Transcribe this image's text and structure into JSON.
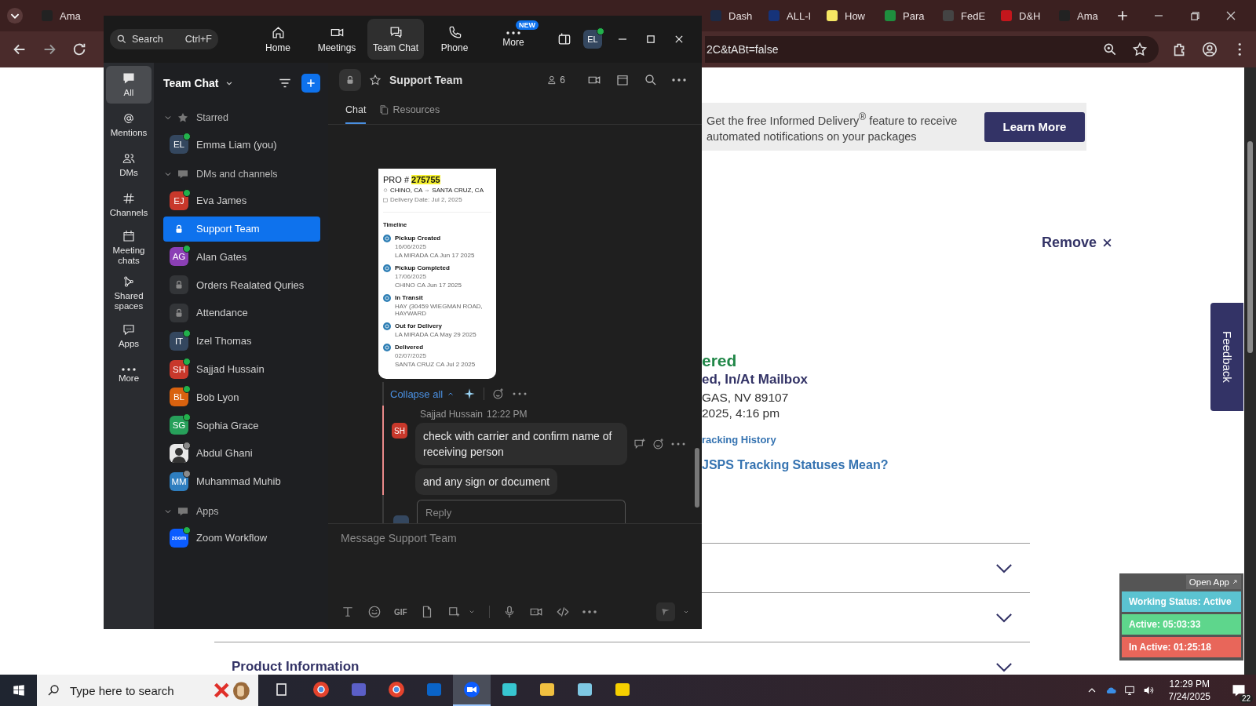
{
  "browser": {
    "tabs": [
      {
        "label": "Ama",
        "selected": false
      },
      {
        "label": "Dash",
        "selected": false
      },
      {
        "label": "ALL-I",
        "selected": false
      },
      {
        "label": "How",
        "selected": false
      },
      {
        "label": "Para",
        "selected": false
      },
      {
        "label": "FedE",
        "selected": false
      },
      {
        "label": "D&H",
        "selected": false
      },
      {
        "label": "Ama",
        "selected": false
      }
    ],
    "address": "2C&tABt=false"
  },
  "zoom": {
    "search": {
      "placeholder": "Search",
      "shortcut": "Ctrl+F"
    },
    "nav": [
      {
        "label": "Home",
        "selected": false
      },
      {
        "label": "Meetings",
        "selected": false
      },
      {
        "label": "Team Chat",
        "selected": true
      },
      {
        "label": "Phone",
        "selected": false
      },
      {
        "label": "More",
        "selected": false,
        "badge": "NEW"
      }
    ],
    "avatar": "EL",
    "rail": [
      {
        "label": "All",
        "selected": true
      },
      {
        "label": "Mentions",
        "selected": false
      },
      {
        "label": "DMs",
        "selected": false
      },
      {
        "label": "Channels",
        "selected": false
      },
      {
        "label": "Meeting chats",
        "selected": false
      },
      {
        "label": "Shared spaces",
        "selected": false
      },
      {
        "label": "Apps",
        "selected": false
      },
      {
        "label": "More",
        "selected": false
      }
    ],
    "sidebar": {
      "title": "Team Chat",
      "sections": [
        {
          "label": "Starred",
          "expanded": true,
          "items": [
            {
              "name": "Emma Liam (you)",
              "kind": "person",
              "initials": "EL",
              "color": "#34475f",
              "online": true,
              "selected": false
            }
          ]
        },
        {
          "label": "DMs and channels",
          "expanded": true,
          "items": [
            {
              "name": "Eva James",
              "kind": "person",
              "initials": "EJ",
              "color": "#c8382b",
              "online": true,
              "selected": false
            },
            {
              "name": "Support Team",
              "kind": "channel",
              "selected": true
            },
            {
              "name": "Alan Gates",
              "kind": "person",
              "initials": "AG",
              "color": "#8b3fb5",
              "online": true,
              "selected": false
            },
            {
              "name": "Orders Realated Quries",
              "kind": "channel",
              "selected": false
            },
            {
              "name": "Attendance",
              "kind": "channel",
              "selected": false
            },
            {
              "name": "Izel Thomas",
              "kind": "person",
              "initials": "IT",
              "color": "#34475f",
              "online": true,
              "selected": false
            },
            {
              "name": "Sajjad Hussain",
              "kind": "person",
              "initials": "SH",
              "color": "#c8382b",
              "online": true,
              "selected": false
            },
            {
              "name": "Bob Lyon",
              "kind": "person",
              "initials": "BL",
              "color": "#d9620f",
              "online": true,
              "selected": false
            },
            {
              "name": "Sophia Grace",
              "kind": "person",
              "initials": "SG",
              "color": "#27a05a",
              "online": true,
              "selected": false
            },
            {
              "name": "Abdul Ghani",
              "kind": "photo",
              "online": false,
              "selected": false
            },
            {
              "name": "Muhammad Muhib",
              "kind": "person",
              "initials": "MM",
              "color": "#2e7ebf",
              "online": false,
              "selected": false
            }
          ]
        },
        {
          "label": "Apps",
          "expanded": true,
          "items": [
            {
              "name": "Zoom Workflow",
              "kind": "app",
              "initials": "zoom",
              "color": "#0b5cff",
              "online": true,
              "selected": false
            }
          ]
        }
      ]
    },
    "chat": {
      "title": "Support Team",
      "members": "6",
      "tabs": [
        {
          "label": "Chat",
          "selected": true
        },
        {
          "label": "Resources",
          "selected": false
        }
      ],
      "card": {
        "pro_label": "PRO #",
        "pro_number": "275755",
        "origin": "CHINO, CA",
        "destination": "SANTA CRUZ, CA",
        "delivery_date": "Delivery Date: Jul 2, 2025",
        "timeline_title": "Timeline",
        "events": [
          {
            "title": "Pickup Created",
            "date": "16/06/2025",
            "place": "LA MIRADA CA Jun 17 2025"
          },
          {
            "title": "Pickup Completed",
            "date": "17/06/2025",
            "place": "CHINO CA Jun 17 2025"
          },
          {
            "title": "In Transit",
            "place": "HAY (30459 WIEGMAN ROAD, HAYWARD"
          },
          {
            "title": "Out for Delivery",
            "place": "LA MIRADA CA May 29 2025"
          },
          {
            "title": "Delivered",
            "date": "02/07/2025",
            "place": "SANTA CRUZ CA Jul 2 2025"
          }
        ]
      },
      "collapse": "Collapse all",
      "message": {
        "author": "Sajjad Hussain",
        "time": "12:22 PM",
        "initials": "SH",
        "color": "#c8382b",
        "bubbles": [
          "check with carrier and confirm name of receiving person",
          "and any sign or document"
        ]
      },
      "reply": {
        "placeholder": "Reply"
      },
      "composer": {
        "placeholder": "Message Support Team",
        "gif": "GIF"
      }
    }
  },
  "page": {
    "banner": {
      "text": "Get the free Informed Delivery$^{®}$ feature to receive automated notifications on your packages",
      "button": "Learn More"
    },
    "remove": "Remove",
    "status": "ered",
    "status_detail": "ed, In/At Mailbox",
    "location": "GAS, NV 89107",
    "datetime": "2025, 4:16 pm",
    "history_link": "racking History",
    "statuses_link": "JSPS Tracking Statuses Mean?",
    "accordions": [
      {
        "expanded": false
      },
      {
        "expanded": false
      },
      {
        "label": "Product Information",
        "expanded": false
      }
    ],
    "feedback": "Feedback"
  },
  "widget": {
    "open_app": "Open App",
    "rows": [
      {
        "label": "Working Status: Active",
        "color": "#5bc3d1"
      },
      {
        "label": "Active: 05:03:33",
        "color": "#5ed68c"
      },
      {
        "label": "In Active: 01:25:18",
        "color": "#e8665a"
      }
    ]
  },
  "taskbar": {
    "search_placeholder": "Type here to search",
    "apps": [
      {
        "selected": false
      },
      {
        "selected": false
      },
      {
        "selected": false
      },
      {
        "selected": false
      },
      {
        "selected": false
      },
      {
        "selected": true
      },
      {
        "selected": false
      },
      {
        "selected": false
      },
      {
        "selected": false
      },
      {
        "selected": false
      }
    ],
    "time": "12:29 PM",
    "date": "7/24/2025",
    "notifications": "22"
  }
}
